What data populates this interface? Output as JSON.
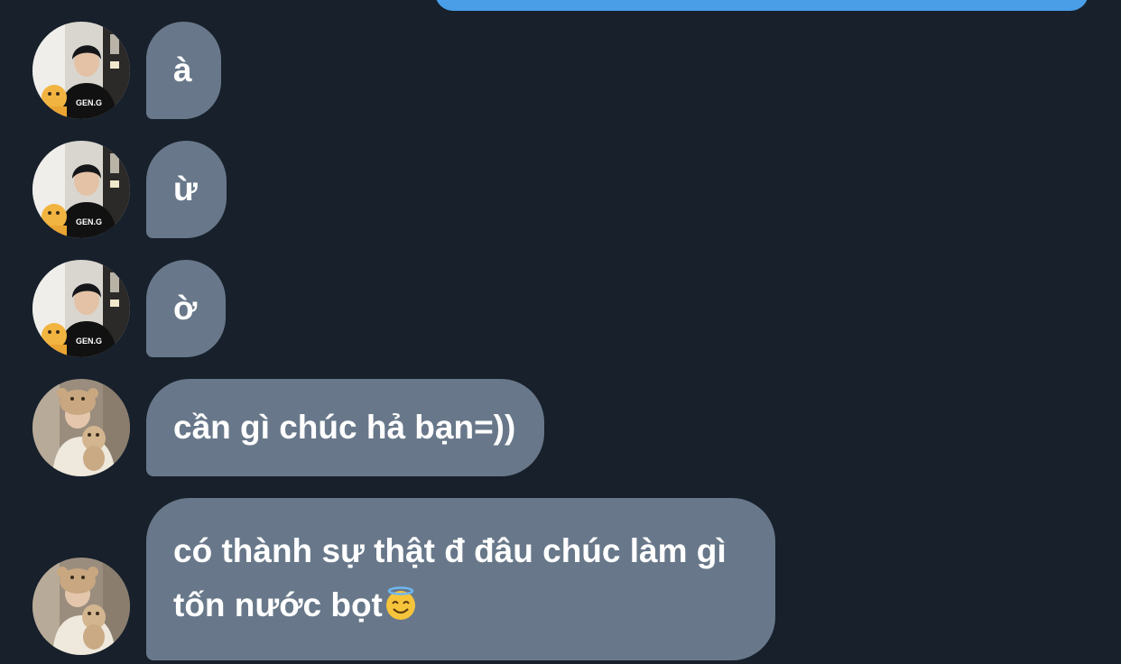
{
  "messages": [
    {
      "text": "à",
      "avatar_icon": "avatar-boy-icon"
    },
    {
      "text": "ừ",
      "avatar_icon": "avatar-boy-icon"
    },
    {
      "text": "ờ",
      "avatar_icon": "avatar-boy-icon"
    },
    {
      "text": "cần gì chúc hả bạn=))",
      "avatar_icon": "avatar-bear-hat-icon"
    },
    {
      "text_line1": "có thành sự thật đ đâu chúc làm gì",
      "text_line2": "tốn nước bọt",
      "emoji_icon": "smiling-face-with-halo-icon",
      "avatar_icon": "avatar-bear-hat-icon"
    }
  ],
  "colors": {
    "background": "#17202b",
    "received_bubble": "#68788a",
    "sent_bubble": "#4a9ee8",
    "text": "#ffffff"
  }
}
